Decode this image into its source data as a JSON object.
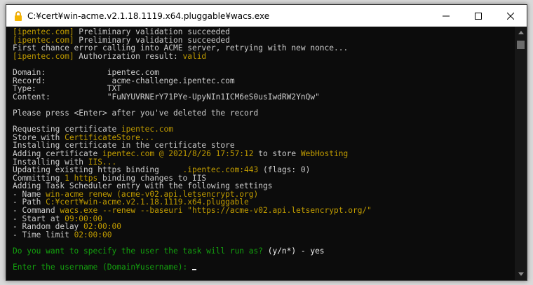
{
  "window": {
    "title": "C:¥cert¥win-acme.v2.1.18.1119.x64.pluggable¥wacs.exe",
    "icon": "padlock-app-icon",
    "controls": [
      "minimize-icon",
      "maximize-icon",
      "close-icon"
    ]
  },
  "colors": {
    "background": "#0c0c0c",
    "text": "#cccccc",
    "highlight": "#c19c00",
    "prompt": "#13a10e",
    "input": "#f2f2f2"
  },
  "console": {
    "lines": [
      [
        {
          "t": "[ipentec.com]",
          "c": "yellow"
        },
        {
          "t": " Preliminary validation succeeded",
          "c": "gray"
        }
      ],
      [
        {
          "t": "[ipentec.com]",
          "c": "yellow"
        },
        {
          "t": " Preliminary validation succeeded",
          "c": "gray"
        }
      ],
      [
        {
          "t": "First chance error calling into ACME server, retrying with new nonce...",
          "c": "gray"
        }
      ],
      [
        {
          "t": "[ipentec.com]",
          "c": "yellow"
        },
        {
          "t": " Authorization result: ",
          "c": "gray"
        },
        {
          "t": "valid",
          "c": "yellow"
        }
      ],
      [],
      [
        {
          "t": "Domain:             ipentec.com",
          "c": "gray"
        }
      ],
      [
        {
          "t": "Record:             _acme-challenge.ipentec.com",
          "c": "gray"
        }
      ],
      [
        {
          "t": "Type:               TXT",
          "c": "gray"
        }
      ],
      [
        {
          "t": "Content:            \"FuNYUVRNErY71PYe-UpyNIn1ICM6eS0usIwdRW2YnQw\"",
          "c": "gray"
        }
      ],
      [],
      [
        {
          "t": "Please press <Enter> after you've deleted the record",
          "c": "gray"
        }
      ],
      [],
      [
        {
          "t": "Requesting certificate ",
          "c": "gray"
        },
        {
          "t": "ipentec.com",
          "c": "yellow"
        }
      ],
      [
        {
          "t": "Store with ",
          "c": "gray"
        },
        {
          "t": "CertificateStore...",
          "c": "yellow"
        }
      ],
      [
        {
          "t": "Installing certificate in the certificate store",
          "c": "gray"
        }
      ],
      [
        {
          "t": "Adding certificate ",
          "c": "gray"
        },
        {
          "t": "ipentec.com @ 2021/8/26 17:57:12",
          "c": "yellow"
        },
        {
          "t": " to store ",
          "c": "gray"
        },
        {
          "t": "WebHosting",
          "c": "yellow"
        }
      ],
      [
        {
          "t": "Installing with ",
          "c": "gray"
        },
        {
          "t": "IIS...",
          "c": "yellow"
        }
      ],
      [
        {
          "t": "Updating existing https binding     ",
          "c": "gray"
        },
        {
          "t": ".ipentec.com:443",
          "c": "yellow"
        },
        {
          "t": " (flags: 0)",
          "c": "gray"
        }
      ],
      [
        {
          "t": "Committing ",
          "c": "gray"
        },
        {
          "t": "1 https",
          "c": "yellow"
        },
        {
          "t": " binding changes to IIS",
          "c": "gray"
        }
      ],
      [
        {
          "t": "Adding Task Scheduler entry with the following settings",
          "c": "gray"
        }
      ],
      [
        {
          "t": "- Name ",
          "c": "gray"
        },
        {
          "t": "win-acme renew (acme-v02.api.letsencrypt.org)",
          "c": "yellow"
        }
      ],
      [
        {
          "t": "- Path ",
          "c": "gray"
        },
        {
          "t": "C:¥cert¥win-acme.v2.1.18.1119.x64.pluggable",
          "c": "yellow"
        }
      ],
      [
        {
          "t": "- Command ",
          "c": "gray"
        },
        {
          "t": "wacs.exe --renew --baseuri \"https://acme-v02.api.letsencrypt.org/\"",
          "c": "yellow"
        }
      ],
      [
        {
          "t": "- Start at ",
          "c": "gray"
        },
        {
          "t": "09:00:00",
          "c": "yellow"
        }
      ],
      [
        {
          "t": "- Random delay ",
          "c": "gray"
        },
        {
          "t": "02:00:00",
          "c": "yellow"
        }
      ],
      [
        {
          "t": "- Time limit ",
          "c": "gray"
        },
        {
          "t": "02:00:00",
          "c": "yellow"
        }
      ],
      [],
      [
        {
          "t": "Do you want to specify the user the task will run as?",
          "c": "green"
        },
        {
          "t": " (y/n*) - yes",
          "c": "white"
        }
      ],
      [],
      [
        {
          "t": "Enter the username (Domain¥username): ",
          "c": "green"
        }
      ]
    ]
  }
}
